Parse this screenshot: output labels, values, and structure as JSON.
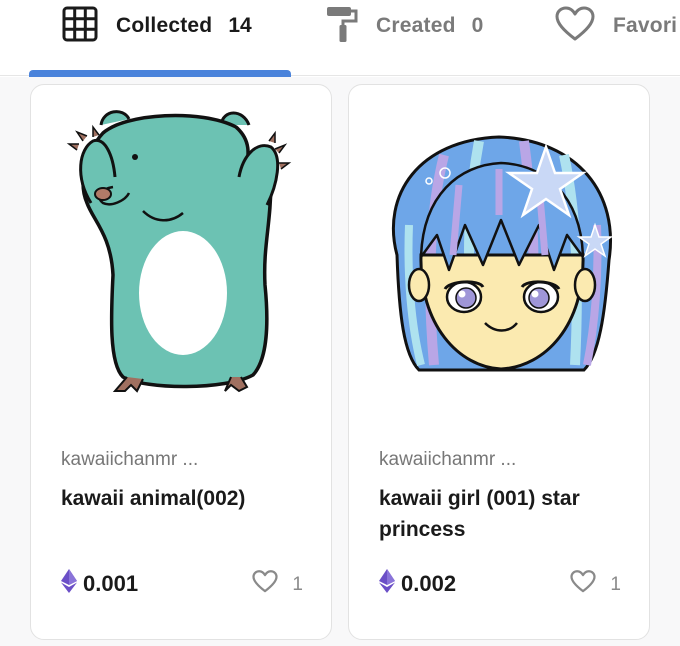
{
  "tabs": [
    {
      "label": "Collected",
      "count": "14",
      "icon": "grid-icon"
    },
    {
      "label": "Created",
      "count": "0",
      "icon": "paint-roller-icon"
    },
    {
      "label": "Favori",
      "icon": "heart-icon"
    }
  ],
  "colors": {
    "accent": "#4a83db",
    "eth": "#6b4fc7"
  },
  "cards": [
    {
      "creator": "kawaiichanmr ...",
      "title": "kawaii animal(002)",
      "price": "0.001",
      "likes": "1",
      "art": "teal-bear-illustration"
    },
    {
      "creator": "kawaiichanmr ...",
      "title": "kawaii girl (001) star princess",
      "price": "0.002",
      "likes": "1",
      "art": "blue-haired-girl-illustration"
    }
  ]
}
